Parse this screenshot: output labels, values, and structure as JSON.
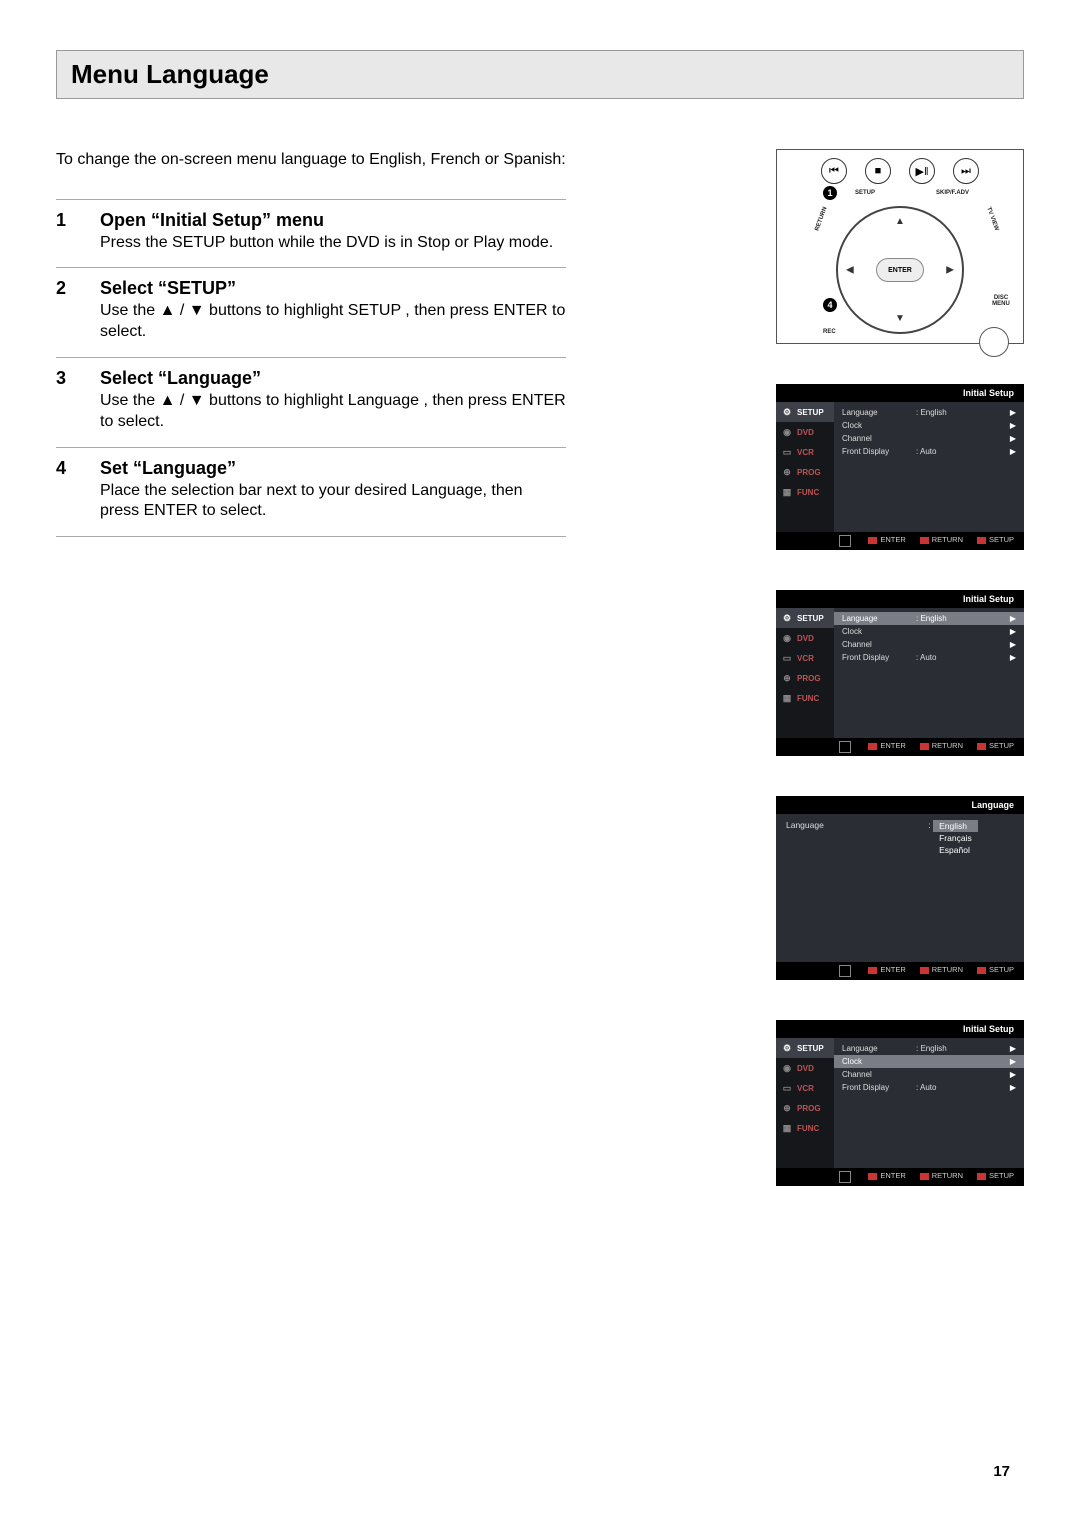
{
  "page_title": "Menu Language",
  "intro": "To change the on-screen menu language to English, French or Spanish:",
  "steps": [
    {
      "num": "1",
      "title": "Open “Initial Setup” menu",
      "body": "Press the SETUP button while the DVD is in Stop or Play mode."
    },
    {
      "num": "2",
      "title": "Select “SETUP”",
      "body": "Use the ▲ / ▼ buttons to highlight SETUP , then press ENTER to select."
    },
    {
      "num": "3",
      "title": "Select “Language”",
      "body": "Use the ▲ / ▼ buttons to highlight Language , then press ENTER to select."
    },
    {
      "num": "4",
      "title": "Set “Language”",
      "body": "Place the selection bar next to your desired Language, then press ENTER to select."
    }
  ],
  "remote": {
    "top_icons": [
      "⏮",
      "■",
      "▶‖",
      "⏭"
    ],
    "callouts": [
      "1",
      "4"
    ],
    "arc_labels": {
      "setup": "SETUP",
      "skip": "SKIP/F.ADV",
      "return": "RETURN",
      "tvview": "TV VIEW",
      "rec": "REC",
      "discmenu": "DISC MENU"
    },
    "enter": "ENTER",
    "arrows": [
      "▲",
      "▼",
      "◀",
      "▶"
    ]
  },
  "osd_common": {
    "tabs": [
      "SETUP",
      "DVD",
      "VCR",
      "PROG",
      "FUNC"
    ],
    "tab_icons": [
      "⚙",
      "◉",
      "▭",
      "⊕",
      "▦"
    ],
    "rows": [
      {
        "label": "Language",
        "value": ": English"
      },
      {
        "label": "Clock",
        "value": ""
      },
      {
        "label": "Channel",
        "value": ""
      },
      {
        "label": "Front Display",
        "value": ": Auto"
      }
    ],
    "footer": {
      "enter": "ENTER",
      "return": "RETURN",
      "setup": "SETUP"
    }
  },
  "osd1": {
    "header": "Initial Setup",
    "active_tab": 0,
    "hl_row": -1
  },
  "osd2": {
    "header": "Initial Setup",
    "active_tab": 0,
    "hl_row": 0
  },
  "osd3": {
    "header": "Language",
    "label": "Language",
    "colon": ":",
    "options": [
      "English",
      "Français",
      "Español"
    ],
    "selected": 0
  },
  "osd4": {
    "header": "Initial Setup",
    "active_tab": 0,
    "hl_row": 1
  },
  "page_number": "17"
}
